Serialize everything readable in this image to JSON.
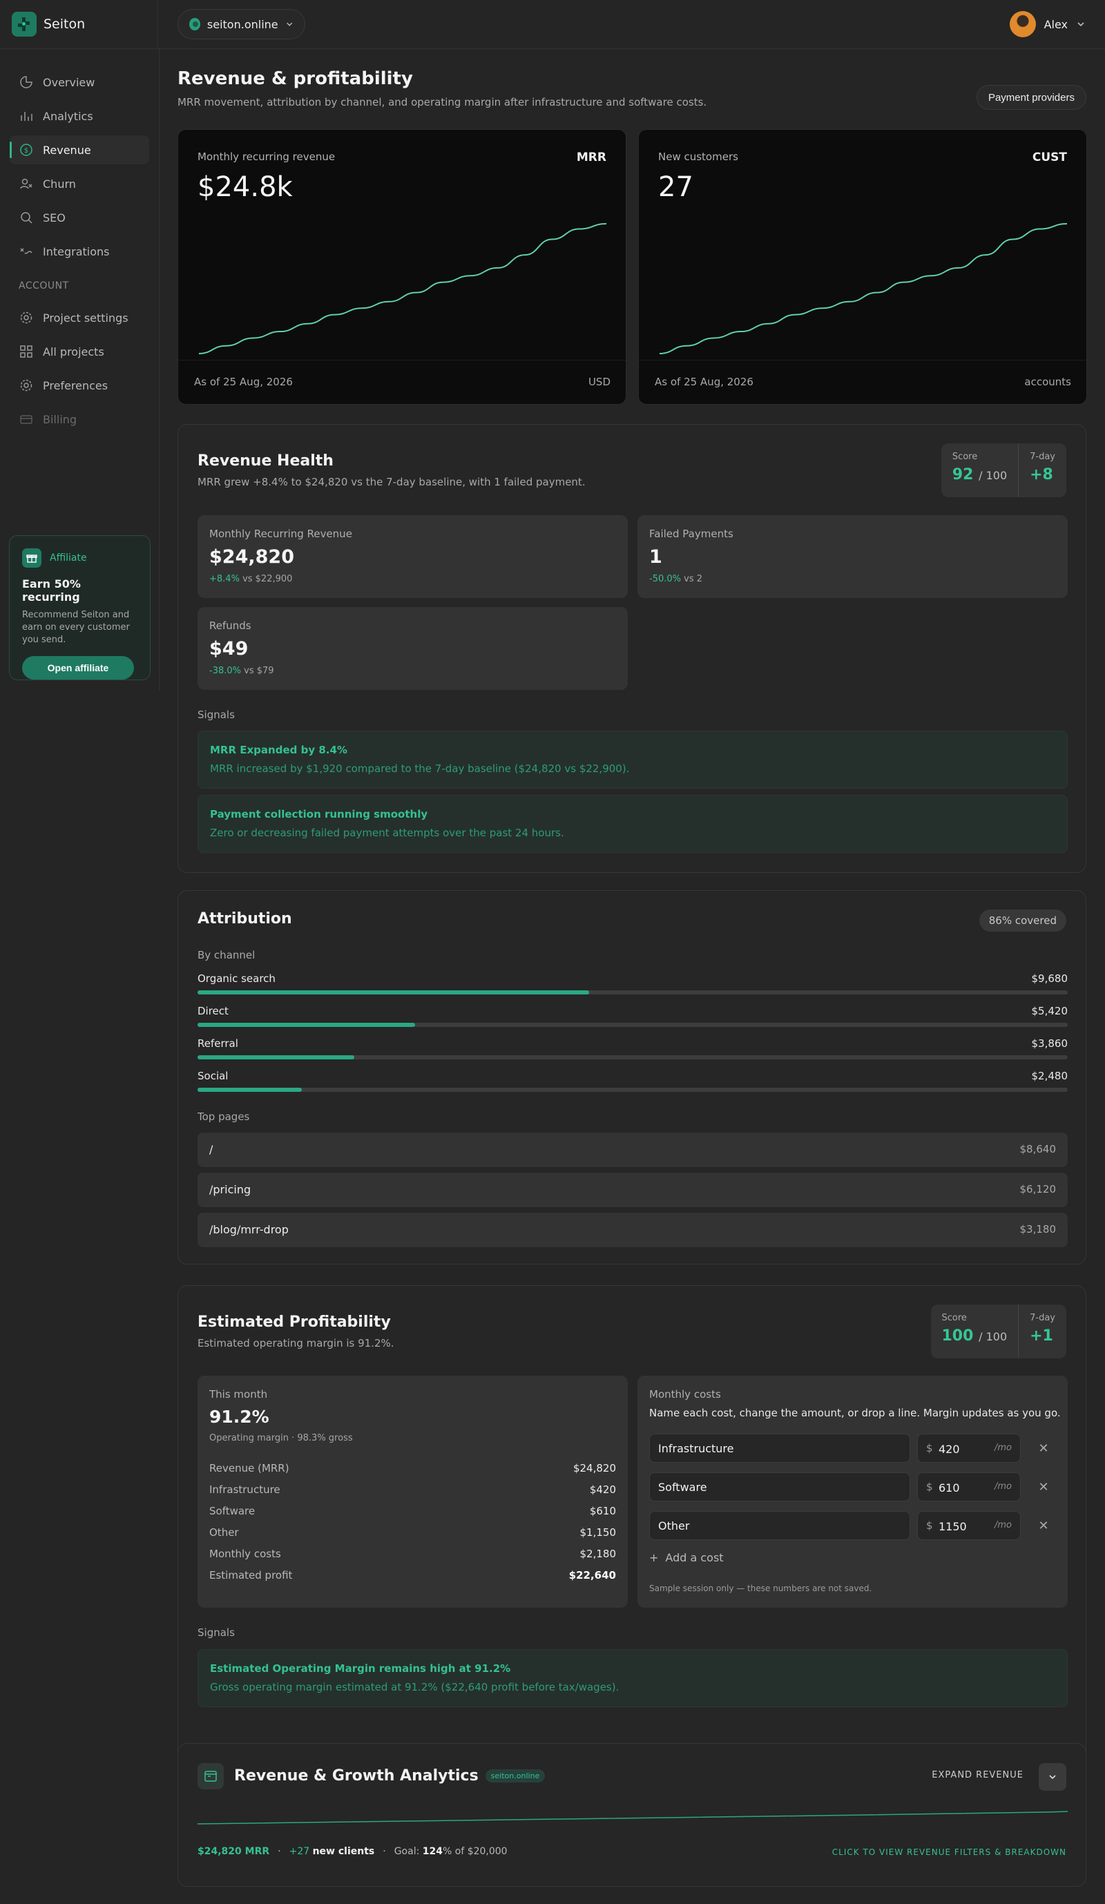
{
  "app": {
    "name": "Seiton"
  },
  "site_selector": {
    "value": "seiton.online"
  },
  "user": {
    "name": "Alex"
  },
  "sidebar": {
    "items": [
      {
        "label": "Overview",
        "icon": "overview-icon"
      },
      {
        "label": "Analytics",
        "icon": "analytics-icon"
      },
      {
        "label": "Revenue",
        "icon": "dollar-icon",
        "active": true
      },
      {
        "label": "Churn",
        "icon": "user-remove-icon"
      },
      {
        "label": "SEO",
        "icon": "search-icon"
      },
      {
        "label": "Integrations",
        "icon": "plug-icon"
      }
    ],
    "account_label": "ACCOUNT",
    "account_items": [
      {
        "label": "Project settings",
        "icon": "gear-icon"
      },
      {
        "label": "All projects",
        "icon": "grid-icon"
      },
      {
        "label": "Preferences",
        "icon": "gear-icon"
      },
      {
        "label": "Billing",
        "icon": "card-icon",
        "disabled": true
      }
    ]
  },
  "affiliate": {
    "tag": "Affiliate",
    "title": "Earn 50% recurring",
    "text": "Recommend Seiton and earn on every customer you send.",
    "button": "Open affiliate"
  },
  "header": {
    "title": "Revenue & profitability",
    "subtitle": "MRR movement, attribution by channel, and operating margin after infrastructure and software costs.",
    "providers_button": "Payment providers"
  },
  "metrics": [
    {
      "label": "Monthly recurring revenue",
      "code": "MRR",
      "value": "$24.8k",
      "date": "As of 25 Aug, 2026",
      "unit": "USD",
      "trend": [
        0,
        0.06,
        0.12,
        0.17,
        0.23,
        0.3,
        0.35,
        0.4,
        0.47,
        0.55,
        0.6,
        0.66,
        0.76,
        0.88,
        0.96,
        1.0
      ]
    },
    {
      "label": "New customers",
      "code": "CUST",
      "value": "27",
      "date": "As of 25 Aug, 2026",
      "unit": "accounts",
      "trend": [
        0,
        0.06,
        0.12,
        0.17,
        0.23,
        0.3,
        0.35,
        0.4,
        0.47,
        0.55,
        0.6,
        0.66,
        0.76,
        0.88,
        0.96,
        1.0
      ]
    }
  ],
  "health": {
    "title": "Revenue Health",
    "subtitle": "MRR grew +8.4% to $24,820 vs the 7-day baseline, with 1 failed payment.",
    "score_label": "Score",
    "score": "92",
    "score_max": "/ 100",
    "delta_label": "7-day",
    "delta": "+8",
    "cards": [
      {
        "label": "Monthly Recurring Revenue",
        "value": "$24,820",
        "delta": "+8.4%",
        "compare": "vs $22,900"
      },
      {
        "label": "Failed Payments",
        "value": "1",
        "delta": "-50.0%",
        "compare": "vs 2"
      },
      {
        "label": "Refunds",
        "value": "$49",
        "delta": "-38.0%",
        "compare": "vs $79"
      }
    ],
    "signals_label": "Signals",
    "signals": [
      {
        "title": "MRR Expanded by 8.4%",
        "text": "MRR increased by $1,920 compared to the 7-day baseline ($24,820 vs $22,900)."
      },
      {
        "title": "Payment collection running smoothly",
        "text": "Zero or decreasing failed payment attempts over the past 24 hours."
      }
    ]
  },
  "attribution": {
    "title": "Attribution",
    "coverage": "86% covered",
    "by_channel_label": "By channel",
    "channels": [
      {
        "name": "Organic search",
        "value": "$9,680",
        "share": 0.45
      },
      {
        "name": "Direct",
        "value": "$5,420",
        "share": 0.25
      },
      {
        "name": "Referral",
        "value": "$3,860",
        "share": 0.18
      },
      {
        "name": "Social",
        "value": "$2,480",
        "share": 0.12
      }
    ],
    "top_pages_label": "Top pages",
    "pages": [
      {
        "path": "/",
        "value": "$8,640"
      },
      {
        "path": "/pricing",
        "value": "$6,120"
      },
      {
        "path": "/blog/mrr-drop",
        "value": "$3,180"
      }
    ]
  },
  "profitability": {
    "title": "Estimated Profitability",
    "subtitle": "Estimated operating margin is 91.2%.",
    "score_label": "Score",
    "score": "100",
    "score_max": "/ 100",
    "delta_label": "7-day",
    "delta": "+1",
    "month_label": "This month",
    "margin": "91.2%",
    "margin_note": "Operating margin · 98.3% gross",
    "rows": [
      {
        "label": "Revenue (MRR)",
        "value": "$24,820"
      },
      {
        "label": "Infrastructure",
        "value": "$420"
      },
      {
        "label": "Software",
        "value": "$610"
      },
      {
        "label": "Other",
        "value": "$1,150"
      },
      {
        "label": "Monthly costs",
        "value": "$2,180"
      },
      {
        "label": "Estimated profit",
        "value": "$22,640"
      }
    ],
    "costs_label": "Monthly costs",
    "costs_help": "Name each cost, change the amount, or drop a line. Margin updates as you go.",
    "currency": "$",
    "per": "/mo",
    "costs": [
      {
        "name": "Infrastructure",
        "amount": "420"
      },
      {
        "name": "Software",
        "amount": "610"
      },
      {
        "name": "Other",
        "amount": "1150"
      }
    ],
    "add_cost": "Add a cost",
    "note": "Sample session only — these numbers are not saved.",
    "signals_label": "Signals",
    "signal": {
      "title": "Estimated Operating Margin remains high at 91.2%",
      "text": "Gross operating margin estimated at 91.2% ($22,640 profit before tax/wages)."
    }
  },
  "growth": {
    "title": "Revenue & Growth Analytics",
    "badge": "seiton.online",
    "expand_label": "EXPAND REVENUE",
    "mrr": "$24,820 MRR",
    "new_clients_count": "+27",
    "new_clients_label": "new clients",
    "goal_prefix": "Goal:",
    "goal_pct": "124",
    "goal_suffix": "% of $20,000",
    "link": "CLICK TO VIEW REVENUE FILTERS & BREAKDOWN"
  },
  "colors": {
    "accent": "#2fb58c",
    "background": "#252525",
    "card": "#0c0c0c"
  }
}
